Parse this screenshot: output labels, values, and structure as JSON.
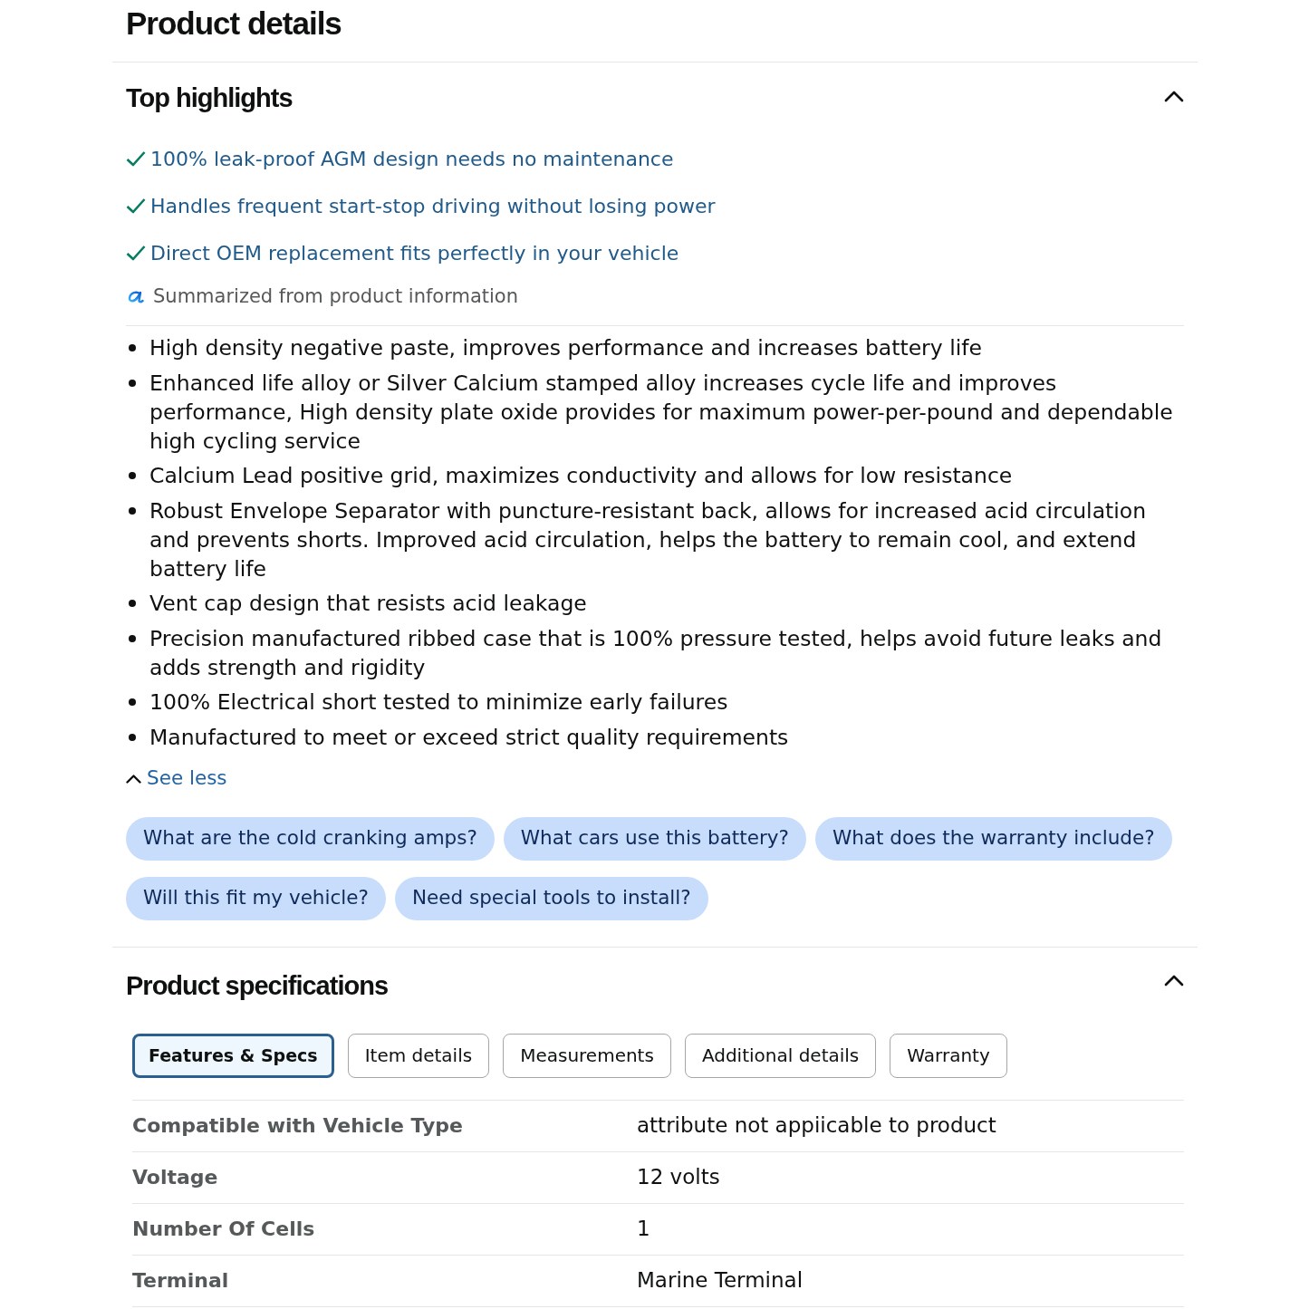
{
  "page_title": "Product details",
  "top_highlights": {
    "title": "Top highlights",
    "expanded": true,
    "highlights": [
      "100% leak-proof AGM design needs no maintenance",
      "Handles frequent start-stop driving without losing power",
      "Direct OEM replacement fits perfectly in your vehicle"
    ],
    "summary_note": "Summarized from product information",
    "bullets": [
      "High density negative paste, improves performance and increases battery life",
      "Enhanced life alloy or Silver Calcium stamped alloy increases cycle life and improves performance, High density plate oxide provides for maximum power-per-pound and dependable high cycling service",
      "Calcium Lead positive grid, maximizes conductivity and allows for low resistance",
      "Robust Envelope Separator with puncture-resistant back, allows for increased acid circulation and prevents shorts. Improved acid circulation, helps the battery to remain cool, and extend battery life",
      "Vent cap design that resists acid leakage",
      "Precision manufactured ribbed case that is 100% pressure tested, helps avoid future leaks and adds strength and rigidity",
      "100% Electrical short tested to minimize early failures",
      "Manufactured to meet or exceed strict quality requirements"
    ],
    "see_less": "See less",
    "suggested_questions": [
      "What are the cold cranking amps?",
      "What cars use this battery?",
      "What does the warranty include?",
      "Will this fit my vehicle?",
      "Need special tools to install?"
    ]
  },
  "product_specifications": {
    "title": "Product specifications",
    "expanded": true,
    "tabs": [
      {
        "label": "Features & Specs",
        "selected": true
      },
      {
        "label": "Item details",
        "selected": false
      },
      {
        "label": "Measurements",
        "selected": false
      },
      {
        "label": "Additional details",
        "selected": false
      },
      {
        "label": "Warranty",
        "selected": false
      }
    ],
    "rows": [
      {
        "label": "Compatible with Vehicle Type",
        "value": "attribute not appiicable to product"
      },
      {
        "label": "Voltage",
        "value": "12 volts"
      },
      {
        "label": "Number Of Cells",
        "value": "1"
      },
      {
        "label": "Terminal",
        "value": "Marine Terminal"
      }
    ]
  }
}
